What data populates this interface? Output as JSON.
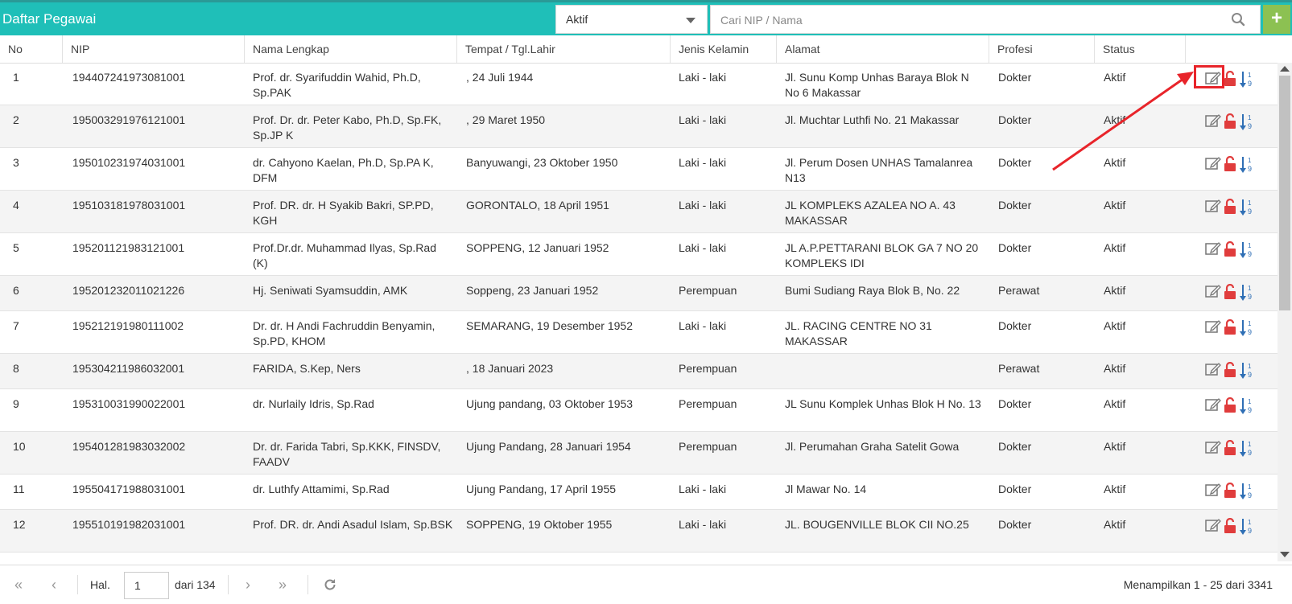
{
  "header": {
    "title": "Daftar Pegawai",
    "status_value": "Aktif",
    "search_placeholder": "Cari NIP / Nama",
    "add_label": "+"
  },
  "columns": [
    "No",
    "NIP",
    "Nama Lengkap",
    "Tempat / Tgl.Lahir",
    "Jenis Kelamin",
    "Alamat",
    "Profesi",
    "Status"
  ],
  "rows": [
    {
      "no": "1",
      "nip": "194407241973081001",
      "nama": "Prof. dr. Syarifuddin Wahid, Ph.D, Sp.PAK",
      "ttl": ", 24 Juli 1944",
      "jk": "Laki - laki",
      "alamat": "Jl. Sunu Komp Unhas Baraya Blok N No 6 Makassar",
      "profesi": "Dokter",
      "status": "Aktif"
    },
    {
      "no": "2",
      "nip": "195003291976121001",
      "nama": "Prof. Dr. dr. Peter Kabo, Ph.D, Sp.FK, Sp.JP K",
      "ttl": ", 29 Maret 1950",
      "jk": "Laki - laki",
      "alamat": "Jl. Muchtar Luthfi No. 21 Makassar",
      "profesi": "Dokter",
      "status": "Aktif"
    },
    {
      "no": "3",
      "nip": "195010231974031001",
      "nama": "dr. Cahyono Kaelan, Ph.D, Sp.PA K, DFM",
      "ttl": "Banyuwangi, 23 Oktober 1950",
      "jk": "Laki - laki",
      "alamat": "Jl. Perum Dosen UNHAS Tamalanrea N13",
      "profesi": "Dokter",
      "status": "Aktif"
    },
    {
      "no": "4",
      "nip": "195103181978031001",
      "nama": "Prof. DR. dr. H Syakib Bakri, SP.PD, KGH",
      "ttl": "GORONTALO, 18 April 1951",
      "jk": "Laki - laki",
      "alamat": "JL KOMPLEKS AZALEA NO A. 43 MAKASSAR",
      "profesi": "Dokter",
      "status": "Aktif"
    },
    {
      "no": "5",
      "nip": "195201121983121001",
      "nama": "Prof.Dr.dr. Muhammad Ilyas, Sp.Rad (K)",
      "ttl": "SOPPENG, 12 Januari 1952",
      "jk": "Laki - laki",
      "alamat": "JL A.P.PETTARANI BLOK GA 7 NO 20 KOMPLEKS IDI",
      "profesi": "Dokter",
      "status": "Aktif"
    },
    {
      "no": "6",
      "nip": "195201232011021226",
      "nama": "Hj. Seniwati Syamsuddin, AMK",
      "ttl": "Soppeng, 23 Januari 1952",
      "jk": "Perempuan",
      "alamat": "Bumi Sudiang Raya Blok B, No. 22",
      "profesi": "Perawat",
      "status": "Aktif"
    },
    {
      "no": "7",
      "nip": "195212191980111002",
      "nama": "Dr. dr. H Andi Fachruddin Benyamin, Sp.PD, KHOM",
      "ttl": "SEMARANG, 19 Desember 1952",
      "jk": "Laki - laki",
      "alamat": "JL. RACING CENTRE NO 31 MAKASSAR",
      "profesi": "Dokter",
      "status": "Aktif"
    },
    {
      "no": "8",
      "nip": "195304211986032001",
      "nama": "FARIDA, S.Kep, Ners",
      "ttl": ", 18 Januari 2023",
      "jk": "Perempuan",
      "alamat": "",
      "profesi": "Perawat",
      "status": "Aktif"
    },
    {
      "no": "9",
      "nip": "195310031990022001",
      "nama": "dr. Nurlaily Idris, Sp.Rad",
      "ttl": "Ujung pandang, 03 Oktober 1953",
      "jk": "Perempuan",
      "alamat": "JL Sunu Komplek Unhas Blok H No. 13",
      "profesi": "Dokter",
      "status": "Aktif"
    },
    {
      "no": "10",
      "nip": "195401281983032002",
      "nama": "Dr. dr. Farida Tabri, Sp.KKK, FINSDV, FAADV",
      "ttl": "Ujung Pandang, 28 Januari 1954",
      "jk": "Perempuan",
      "alamat": "Jl. Perumahan Graha Satelit Gowa",
      "profesi": "Dokter",
      "status": "Aktif"
    },
    {
      "no": "11",
      "nip": "195504171988031001",
      "nama": "dr. Luthfy Attamimi, Sp.Rad",
      "ttl": "Ujung Pandang, 17 April 1955",
      "jk": "Laki - laki",
      "alamat": "Jl Mawar No. 14",
      "profesi": "Dokter",
      "status": "Aktif"
    },
    {
      "no": "12",
      "nip": "195510191982031001",
      "nama": "Prof. DR. dr. Andi Asadul Islam, Sp.BSK",
      "ttl": "SOPPENG, 19 Oktober 1955",
      "jk": "Laki - laki",
      "alamat": "JL. BOUGENVILLE BLOK CII NO.25",
      "profesi": "Dokter",
      "status": "Aktif"
    }
  ],
  "icons": {
    "edit": "edit-icon",
    "unlock": "unlock-icon",
    "sort": "sort-numeric-icon"
  },
  "pager": {
    "page_label": "Hal.",
    "page_value": "1",
    "of_label": "dari 134",
    "summary": "Menampilkan 1 - 25 dari 3341"
  },
  "colors": {
    "header": "#1fbfb8",
    "add": "#8cc152",
    "highlight": "#e8242a",
    "unlock": "#e03c3c",
    "sort": "#2f6fb5"
  }
}
